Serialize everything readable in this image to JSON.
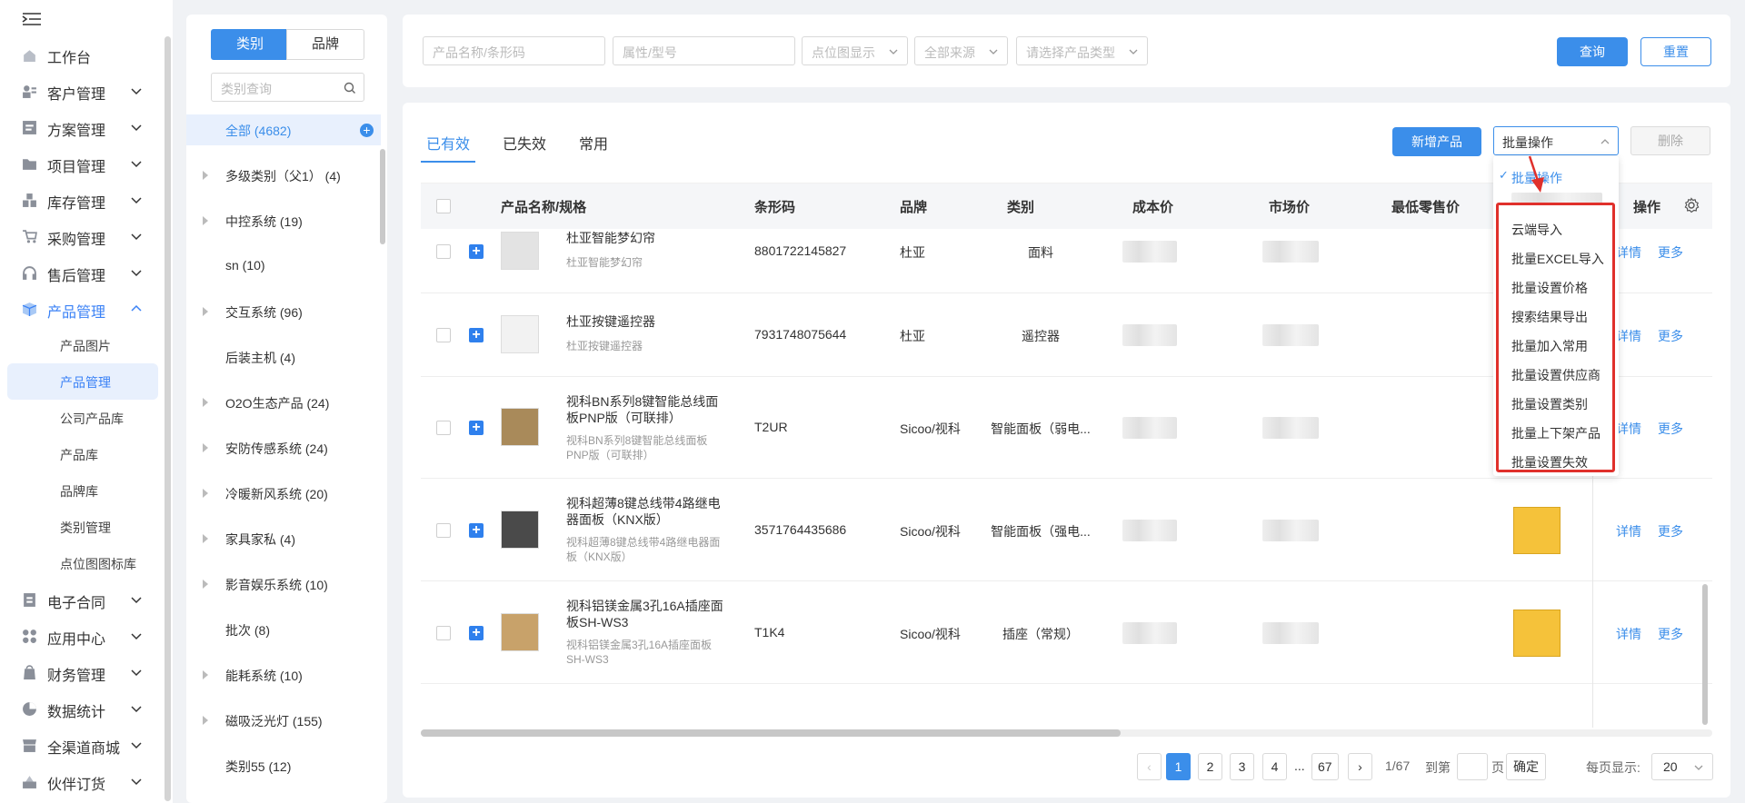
{
  "nav": {
    "items": [
      {
        "label": "工作台",
        "icon": "home-icon"
      },
      {
        "label": "客户管理",
        "icon": "customer-icon"
      },
      {
        "label": "方案管理",
        "icon": "plan-icon"
      },
      {
        "label": "项目管理",
        "icon": "folder-icon"
      },
      {
        "label": "库存管理",
        "icon": "inventory-icon"
      },
      {
        "label": "采购管理",
        "icon": "cart-icon"
      },
      {
        "label": "售后管理",
        "icon": "headset-icon"
      },
      {
        "label": "产品管理",
        "icon": "product-icon"
      },
      {
        "label": "电子合同",
        "icon": "contract-icon"
      },
      {
        "label": "应用中心",
        "icon": "apps-icon"
      },
      {
        "label": "财务管理",
        "icon": "finance-icon"
      },
      {
        "label": "数据统计",
        "icon": "chart-icon"
      },
      {
        "label": "全渠道商城",
        "icon": "store-icon"
      },
      {
        "label": "伙伴订货",
        "icon": "partner-icon"
      }
    ],
    "sub_items": [
      "产品图片",
      "产品管理",
      "公司产品库",
      "产品库",
      "品牌库",
      "类别管理",
      "点位图图标库"
    ]
  },
  "category_panel": {
    "seg_category": "类别",
    "seg_brand": "品牌",
    "search_placeholder": "类别查询",
    "all_label": "全部 (4682)",
    "rows": [
      {
        "label": "多级类别（父1） (4)",
        "expandable": true
      },
      {
        "label": "中控系统 (19)",
        "expandable": true
      },
      {
        "label": "sn (10)",
        "expandable": false
      },
      {
        "label": "交互系统 (96)",
        "expandable": true
      },
      {
        "label": "后装主机 (4)",
        "expandable": false
      },
      {
        "label": "O2O生态产品 (24)",
        "expandable": true
      },
      {
        "label": "安防传感系统 (24)",
        "expandable": true
      },
      {
        "label": "冷暖新风系统 (20)",
        "expandable": true
      },
      {
        "label": "家具家私 (4)",
        "expandable": true
      },
      {
        "label": "影音娱乐系统 (10)",
        "expandable": true
      },
      {
        "label": "批次 (8)",
        "expandable": false
      },
      {
        "label": "能耗系统 (10)",
        "expandable": true
      },
      {
        "label": "磁吸泛光灯 (155)",
        "expandable": true
      },
      {
        "label": "类别55 (12)",
        "expandable": false
      }
    ]
  },
  "filters": {
    "name_placeholder": "产品名称/条形码",
    "model_placeholder": "属性/型号",
    "point_display": "点位图显示",
    "source": "全部来源",
    "type": "请选择产品类型",
    "query": "查询",
    "reset": "重置"
  },
  "tabs": [
    "已有效",
    "已失效",
    "常用"
  ],
  "toolbar": {
    "add_product": "新增产品",
    "batch_select": "批量操作",
    "delete": "删除"
  },
  "dropdown": {
    "selected": "批量操作",
    "options": [
      "云端导入",
      "批量EXCEL导入",
      "批量设置价格",
      "搜索结果导出",
      "批量加入常用",
      "批量设置供应商",
      "批量设置类别",
      "批量上下架产品",
      "批量设置失效"
    ]
  },
  "table": {
    "headers": {
      "name": "产品名称/规格",
      "barcode": "条形码",
      "brand": "品牌",
      "category": "类别",
      "cost": "成本价",
      "market": "市场价",
      "min_retail": "最低零售价",
      "actions": "操作"
    },
    "rows": [
      {
        "name": "杜亚智能梦幻帘",
        "sub": "杜亚智能梦幻帘",
        "barcode": "8801722145827",
        "brand": "杜亚",
        "category": "面料",
        "detail": "详情",
        "more": "更多"
      },
      {
        "name": "杜亚按键遥控器",
        "sub": "杜亚按键遥控器",
        "barcode": "7931748075644",
        "brand": "杜亚",
        "category": "遥控器",
        "detail": "详情",
        "more": "更多"
      },
      {
        "name": "视科BN系列8键智能总线面板PNP版（可联排）",
        "sub": "视科BN系列8键智能总线面板PNP版（可联排）",
        "barcode": "T2UR",
        "brand": "Sicoo/视科",
        "category": "智能面板（弱电...",
        "detail": "详情",
        "more": "更多"
      },
      {
        "name": "视科超薄8键总线带4路继电器面板（KNX版）",
        "sub": "视科超薄8键总线带4路继电器面板（KNX版）",
        "barcode": "3571764435686",
        "brand": "Sicoo/视科",
        "category": "智能面板（强电...",
        "detail": "详情",
        "more": "更多"
      },
      {
        "name": "视科铝镁金属3孔16A插座面板SH-WS3",
        "sub": "视科铝镁金属3孔16A插座面板SH-WS3",
        "barcode": "T1K4",
        "brand": "Sicoo/视科",
        "category": "插座（常规）",
        "detail": "详情",
        "more": "更多"
      }
    ]
  },
  "pagination": {
    "pages": [
      "1",
      "2",
      "3",
      "4",
      "...",
      "67"
    ],
    "current": "1",
    "total": "1/67",
    "goto_label": "到第",
    "page_unit": "页",
    "confirm": "确定",
    "per_page_label": "每页显示:",
    "per_page": "20"
  },
  "colors": {
    "accent": "#3b8eea",
    "highlight_box": "#e0302b"
  }
}
